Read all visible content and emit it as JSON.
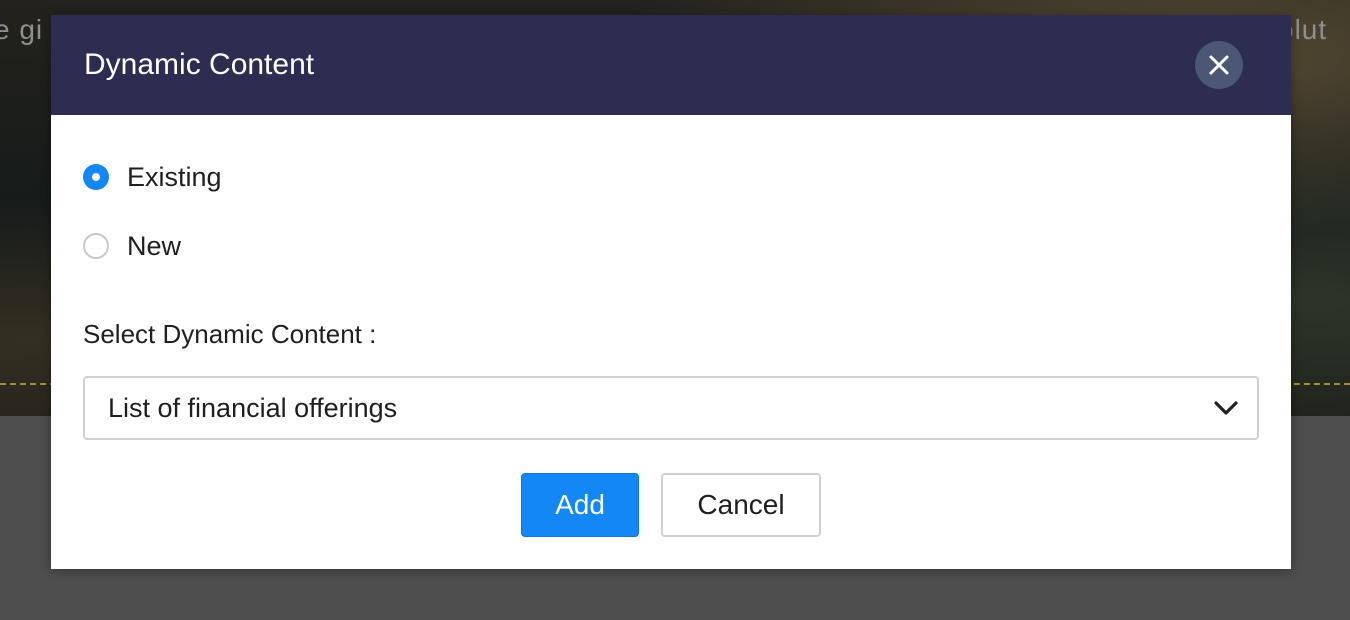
{
  "background": {
    "text_left": "e gi",
    "text_right": "olut"
  },
  "dialog": {
    "title": "Dynamic Content",
    "close_icon": "close-icon",
    "options": [
      {
        "label": "Existing",
        "selected": true
      },
      {
        "label": "New",
        "selected": false
      }
    ],
    "select_label": "Select Dynamic Content :",
    "select_value": "List of financial offerings",
    "add_label": "Add",
    "cancel_label": "Cancel"
  },
  "colors": {
    "header": "#2c2d51",
    "accent": "#1487f6",
    "overlay": "#4e4e4e"
  }
}
